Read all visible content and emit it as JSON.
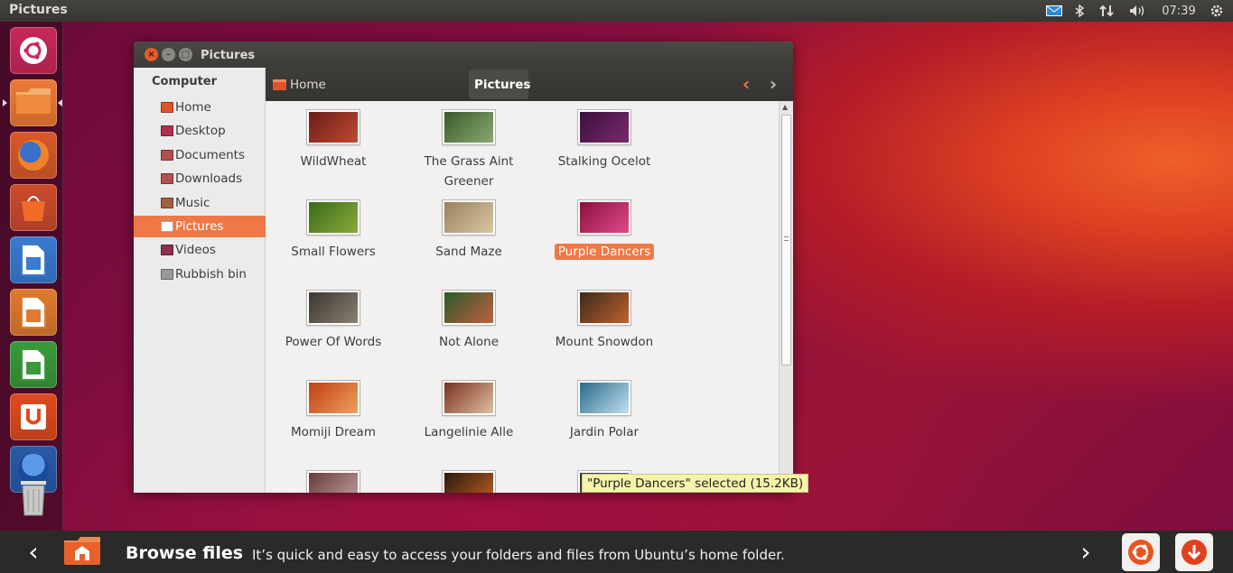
{
  "topbar": {
    "title": "Pictures",
    "clock": "07:39"
  },
  "launcher": {
    "items": [
      {
        "name": "ubuntu-dash-icon",
        "bg": "#c8285a"
      },
      {
        "name": "files-folder-icon",
        "bg": "#ee7a36"
      },
      {
        "name": "firefox-icon",
        "bg": "#d85a2a"
      },
      {
        "name": "software-center-icon",
        "bg": "#cc4b2d"
      },
      {
        "name": "libreoffice-writer-icon",
        "bg": "#3a7ad0"
      },
      {
        "name": "libreoffice-impress-icon",
        "bg": "#e07a30"
      },
      {
        "name": "libreoffice-calc-icon",
        "bg": "#3a9a3a"
      },
      {
        "name": "ubuntu-one-icon",
        "bg": "#e04a1e"
      },
      {
        "name": "thunderbird-icon",
        "bg": "#2a5aa8"
      },
      {
        "name": "rubbish-bin-icon",
        "bg": "#8a8a8a"
      }
    ]
  },
  "window": {
    "title": "Pictures",
    "sidebar": {
      "heading": "Computer",
      "items": [
        {
          "label": "Home",
          "color": "#e0542a"
        },
        {
          "label": "Desktop",
          "color": "#b03050"
        },
        {
          "label": "Documents",
          "color": "#b05050"
        },
        {
          "label": "Downloads",
          "color": "#b05050"
        },
        {
          "label": "Music",
          "color": "#a06040"
        },
        {
          "label": "Pictures",
          "color": "#ffffff"
        },
        {
          "label": "Videos",
          "color": "#8a3050"
        },
        {
          "label": "Rubbish bin",
          "color": "#999999"
        }
      ],
      "selected": "Pictures"
    },
    "path": {
      "home": "Home",
      "current": "Pictures"
    },
    "files": [
      {
        "label": "WildWheat",
        "colors": [
          "#6a1d1a",
          "#c04a30"
        ]
      },
      {
        "label": "The Grass Aint Greener",
        "colors": [
          "#3c5a2a",
          "#8aa870"
        ]
      },
      {
        "label": "Stalking Ocelot",
        "colors": [
          "#3a1040",
          "#7a2a6a"
        ]
      },
      {
        "label": "Small Flowers",
        "colors": [
          "#3a6a1a",
          "#8aaa3a"
        ]
      },
      {
        "label": "Sand Maze",
        "colors": [
          "#9a8060",
          "#d8c8a0"
        ]
      },
      {
        "label": "Purple Dancers",
        "colors": [
          "#8a1040",
          "#e04a8a"
        ]
      },
      {
        "label": "Power Of Words",
        "colors": [
          "#3a3630",
          "#8a8070"
        ]
      },
      {
        "label": "Not Alone",
        "colors": [
          "#2a5a2a",
          "#c06040"
        ]
      },
      {
        "label": "Mount Snowdon",
        "colors": [
          "#3a2a1a",
          "#c06030"
        ]
      },
      {
        "label": "Momiji Dream",
        "colors": [
          "#c04010",
          "#f0a060"
        ]
      },
      {
        "label": "Langelinie Alle",
        "colors": [
          "#7a3020",
          "#e0c0a0"
        ]
      },
      {
        "label": "Jardin Polar",
        "colors": [
          "#2a6a8a",
          "#c0e0f0"
        ]
      },
      {
        "label": "",
        "colors": [
          "#6a3a3a",
          "#c0a0a0"
        ]
      },
      {
        "label": "",
        "colors": [
          "#2a1a10",
          "#c06020"
        ]
      },
      {
        "label": "",
        "colors": [
          "#303030",
          "#707070"
        ]
      }
    ],
    "selected_file": "Purple Dancers",
    "status": "\"Purple Dancers\" selected (15.2KB)"
  },
  "bottombar": {
    "title": "Browse files",
    "description": "It’s quick and easy to access your folders and files from Ubuntu’s home folder."
  }
}
